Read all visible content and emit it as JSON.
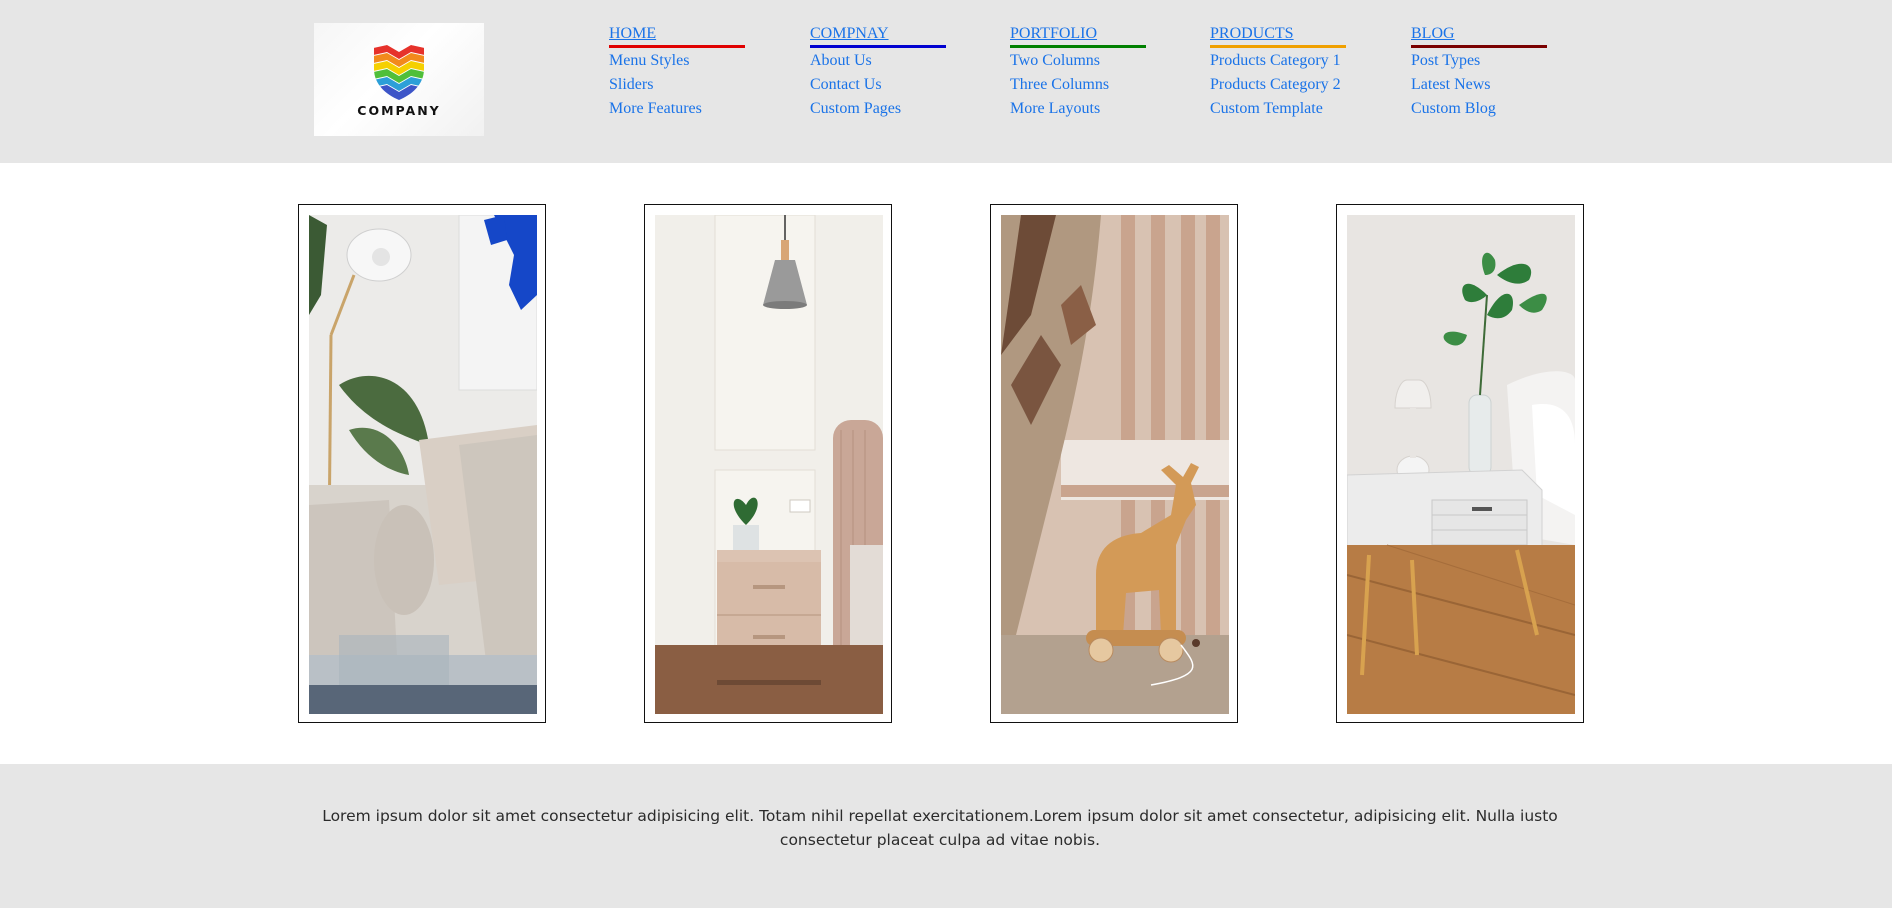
{
  "brand": {
    "logo_text": "COMPANY"
  },
  "nav": [
    {
      "title": "HOME",
      "color": "#e00000",
      "items": [
        "Menu Styles",
        "Sliders",
        "More Features"
      ]
    },
    {
      "title": "COMPNAY",
      "color": "#0000d0",
      "items": [
        "About Us",
        "Contact Us",
        "Custom Pages"
      ]
    },
    {
      "title": "PORTFOLIO",
      "color": "#008000",
      "items": [
        "Two Columns",
        "Three Columns",
        "More Layouts"
      ]
    },
    {
      "title": "PRODUCTS",
      "color": "#f0a000",
      "items": [
        "Products Category 1",
        "Products Category 2",
        "Custom Template"
      ]
    },
    {
      "title": "BLOG",
      "color": "#7a0000",
      "items": [
        "Post Types",
        "Latest News",
        "Custom Blog"
      ]
    }
  ],
  "footer": {
    "text": "Lorem ipsum dolor sit amet consectetur adipisicing elit. Totam nihil repellat exercitationem.Lorem ipsum dolor sit amet consectetur, adipisicing elit. Nulla iusto consectetur placeat culpa ad vitae nobis."
  }
}
